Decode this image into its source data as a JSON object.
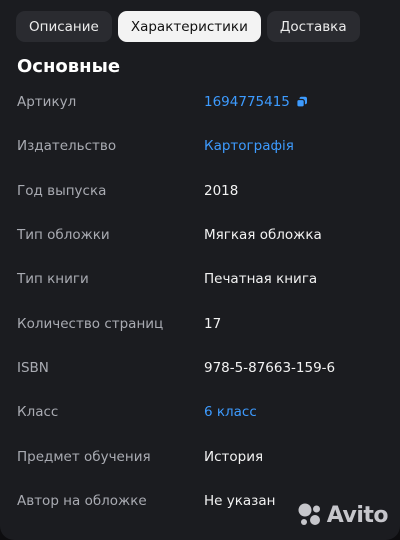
{
  "tabs": [
    {
      "label": "Описание",
      "active": false
    },
    {
      "label": "Характеристики",
      "active": true
    },
    {
      "label": "Доставка",
      "active": false
    }
  ],
  "section_title": "Основные",
  "rows": [
    {
      "label": "Артикул",
      "value": "1694775415",
      "link": true,
      "icon": "copy-icon"
    },
    {
      "label": "Издательство",
      "value": "Картографія",
      "link": true
    },
    {
      "label": "Год выпуска",
      "value": "2018",
      "link": false
    },
    {
      "label": "Тип обложки",
      "value": "Мягкая обложка",
      "link": false
    },
    {
      "label": "Тип книги",
      "value": "Печатная книга",
      "link": false
    },
    {
      "label": "Количество страниц",
      "value": "17",
      "link": false
    },
    {
      "label": "ISBN",
      "value": "978-5-87663-159-6",
      "link": false
    },
    {
      "label": "Класс",
      "value": "6 класс",
      "link": true
    },
    {
      "label": "Предмет обучения",
      "value": "История",
      "link": false
    },
    {
      "label": "Автор на обложке",
      "value": "Не указан",
      "link": false
    }
  ],
  "watermark": {
    "text": "Avito",
    "icon": "avito-dots-icon"
  },
  "colors": {
    "link": "#3d9bff",
    "background": "#1b1c20",
    "tab_active": "#f3f3f3"
  }
}
